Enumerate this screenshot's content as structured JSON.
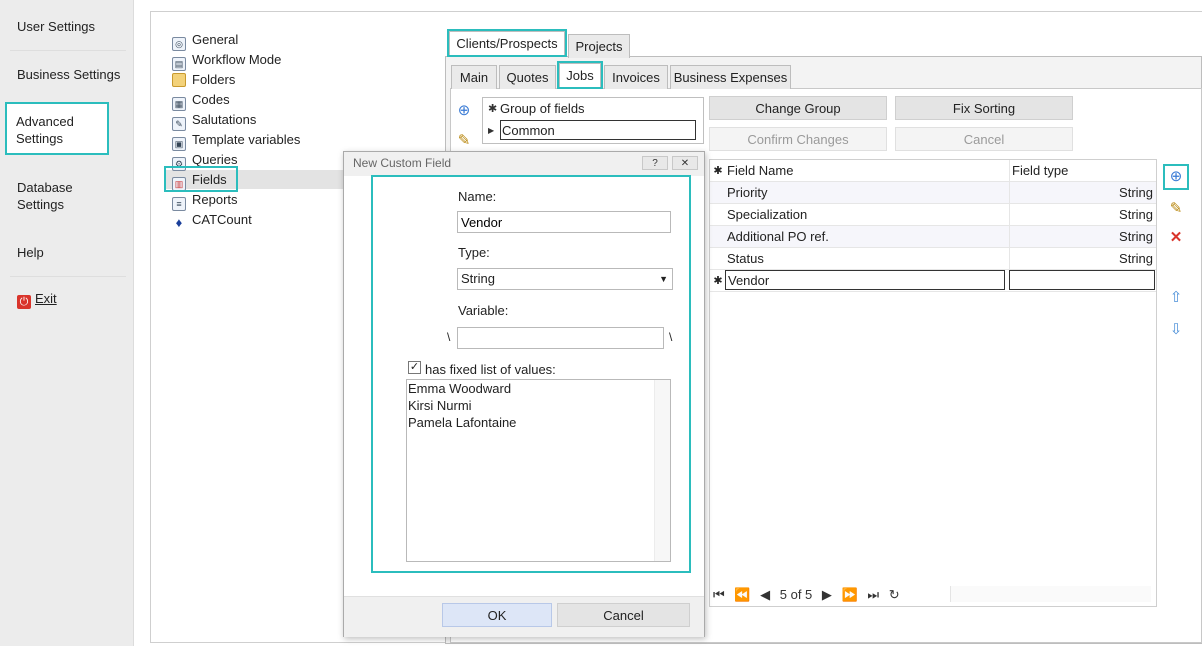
{
  "nav": {
    "items": [
      {
        "label": "User Settings"
      },
      {
        "label": "Business Settings"
      },
      {
        "label": "Advanced Settings",
        "selected": true
      },
      {
        "label": "Database Settings"
      },
      {
        "label": "Help"
      },
      {
        "label": "Exit",
        "icon": "power-icon"
      }
    ]
  },
  "tree": {
    "items": [
      {
        "label": "General",
        "icon": "general-icon"
      },
      {
        "label": "Workflow Mode",
        "icon": "workflow-icon"
      },
      {
        "label": "Folders",
        "icon": "folder-icon"
      },
      {
        "label": "Codes",
        "icon": "codes-icon"
      },
      {
        "label": "Salutations",
        "icon": "salutations-icon"
      },
      {
        "label": "Template variables",
        "icon": "template-icon"
      },
      {
        "label": "Queries",
        "icon": "queries-icon"
      },
      {
        "label": "Fields",
        "icon": "fields-icon",
        "selected": true
      },
      {
        "label": "Reports",
        "icon": "reports-icon"
      },
      {
        "label": "CATCount",
        "icon": "catcount-icon"
      }
    ]
  },
  "tabs": {
    "top": [
      {
        "label": "Clients/Prospects",
        "active": true
      },
      {
        "label": "Projects"
      }
    ],
    "sub": [
      {
        "label": "Main"
      },
      {
        "label": "Quotes"
      },
      {
        "label": "Jobs",
        "active": true
      },
      {
        "label": "Invoices"
      },
      {
        "label": "Business Expenses"
      }
    ]
  },
  "groups": {
    "header": "Group of fields",
    "rows": [
      {
        "label": "Common"
      }
    ]
  },
  "buttons": {
    "change_group": "Change Group",
    "fix_sorting": "Fix Sorting",
    "confirm_changes": "Confirm Changes",
    "cancel": "Cancel"
  },
  "fields_grid": {
    "col_name": "Field Name",
    "col_type": "Field type",
    "rows": [
      {
        "name": "Priority",
        "type": "String"
      },
      {
        "name": "Specialization",
        "type": "String"
      },
      {
        "name": "Additional PO ref.",
        "type": "String"
      },
      {
        "name": "Status",
        "type": "String"
      }
    ],
    "new_row": {
      "name": "Vendor",
      "type": ""
    }
  },
  "pager": {
    "text": "5 of 5"
  },
  "dialog": {
    "title": "New Custom Field",
    "help_btn": "?",
    "close_btn": "✕",
    "name_label": "Name:",
    "name_value": "Vendor",
    "type_label": "Type:",
    "type_value": "String",
    "variable_label": "Variable:",
    "variable_value": "",
    "var_prefix": "\\",
    "var_suffix": "\\",
    "fixed_list_label": "has fixed list of values:",
    "fixed_list_checked": true,
    "values": [
      "Emma Woodward",
      "Kirsi Nurmi",
      "Pamela Lafontaine"
    ],
    "ok_label": "OK",
    "cancel_label": "Cancel"
  },
  "colors": {
    "highlight": "#2bbdbd",
    "accent": "#3a7bd5",
    "delete": "#d9342b"
  }
}
